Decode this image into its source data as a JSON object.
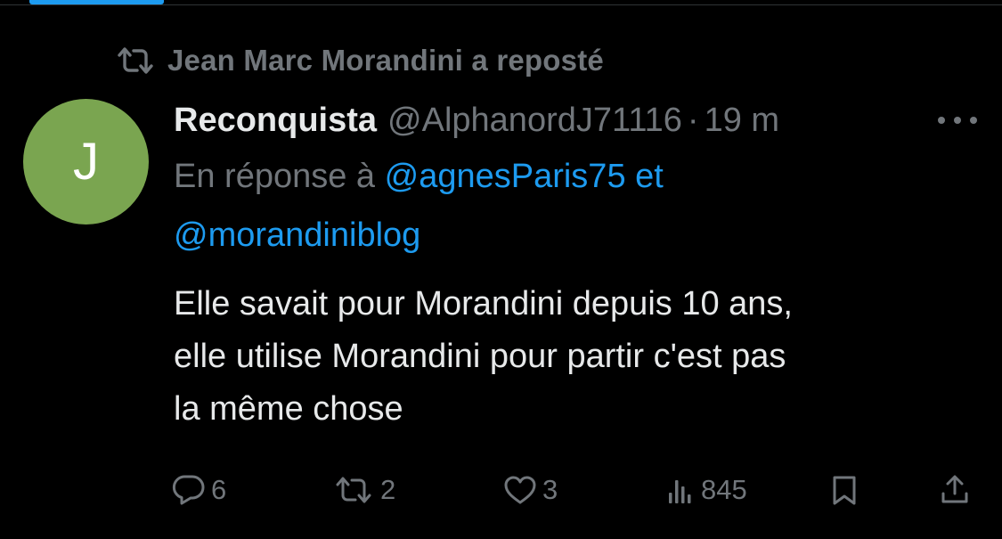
{
  "repost": {
    "text": "Jean Marc Morandini a reposté"
  },
  "tweet": {
    "avatar_letter": "J",
    "avatar_color": "#7aa550",
    "display_name": "Reconquista",
    "handle": "@AlphanordJ71116",
    "separator": "·",
    "time": "19 m",
    "reply_prefix": "En réponse à",
    "reply_mention_1": "@agnesParis75",
    "reply_joiner": "et",
    "reply_mention_2": "@morandiniblog",
    "text_line_1": "Elle savait pour Morandini depuis 10 ans,",
    "text_line_2": "elle utilise Morandini pour partir c'est pas",
    "text_line_3": "la même chose"
  },
  "actions": {
    "replies": "6",
    "reposts": "2",
    "likes": "3",
    "views": "845"
  },
  "colors": {
    "background": "#000000",
    "text_primary": "#e7e9ea",
    "text_secondary": "#71767b",
    "accent": "#1d9bf0"
  },
  "icons": [
    "repost-icon",
    "more-icon",
    "reply-icon",
    "repost-icon",
    "like-icon",
    "views-icon",
    "bookmark-icon",
    "share-icon"
  ]
}
